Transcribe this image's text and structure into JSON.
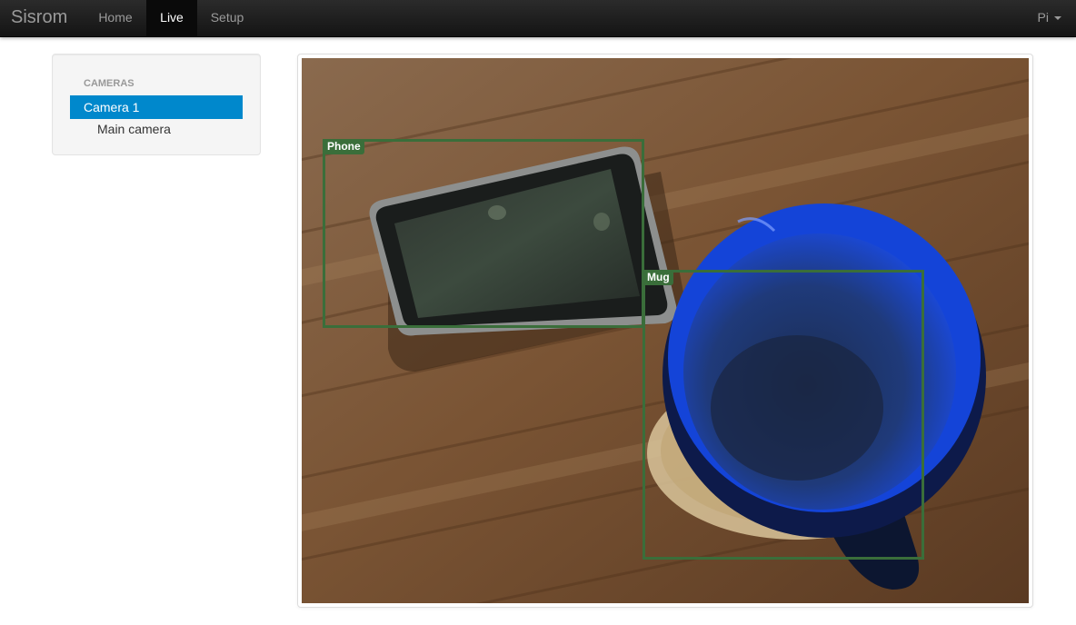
{
  "navbar": {
    "brand": "Sisrom",
    "items": [
      {
        "label": "Home",
        "active": false
      },
      {
        "label": "Live",
        "active": true
      },
      {
        "label": "Setup",
        "active": false
      }
    ],
    "user_label": "Pi"
  },
  "sidebar": {
    "header": "CAMERAS",
    "cameras": [
      {
        "label": "Camera 1",
        "selected": true,
        "streams": [
          {
            "label": "Main camera"
          }
        ]
      }
    ]
  },
  "live_view": {
    "detections": [
      {
        "label": "Phone"
      },
      {
        "label": "Mug"
      }
    ]
  },
  "colors": {
    "navbar_bg": "#1b1b1b",
    "accent": "#0088cc",
    "detection_box": "#3a6e3a"
  }
}
